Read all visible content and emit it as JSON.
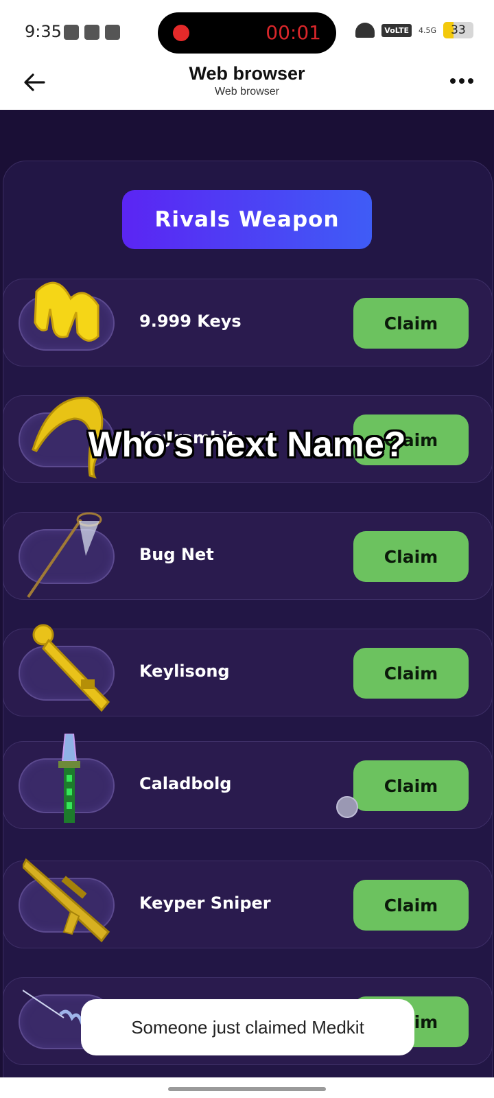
{
  "status_bar": {
    "time": "9:35",
    "recording_time": "00:01",
    "network_badge": "VoLTE",
    "signal_label": "4.5G",
    "battery_level": "33"
  },
  "app_bar": {
    "title": "Web browser",
    "subtitle": "Web browser"
  },
  "page": {
    "header": "Rivals Weapon",
    "overlay_caption": "Who's next Name?",
    "items": [
      {
        "name": "9.999 Keys",
        "claim_label": "Claim",
        "icon": "yellow-key-bundle-icon"
      },
      {
        "name": "Keyrambit",
        "claim_label": "Claim",
        "icon": "golden-karambit-icon"
      },
      {
        "name": "Bug Net",
        "claim_label": "Claim",
        "icon": "bug-net-icon"
      },
      {
        "name": "Keylisong",
        "claim_label": "Claim",
        "icon": "golden-key-sword-icon"
      },
      {
        "name": "Caladbolg",
        "claim_label": "Claim",
        "icon": "green-crystal-sword-icon"
      },
      {
        "name": "Keyper Sniper",
        "claim_label": "Claim",
        "icon": "golden-sniper-icon"
      },
      {
        "name": "",
        "claim_label": "Claim",
        "icon": "spring-weapon-icon"
      }
    ],
    "toast": "Someone just claimed Medkit"
  },
  "colors": {
    "background": "#1a0f36",
    "card": "#2a1b4e",
    "claim_button": "#6cc25f",
    "header_gradient_start": "#5b25f3",
    "header_gradient_end": "#3f5cf6"
  }
}
